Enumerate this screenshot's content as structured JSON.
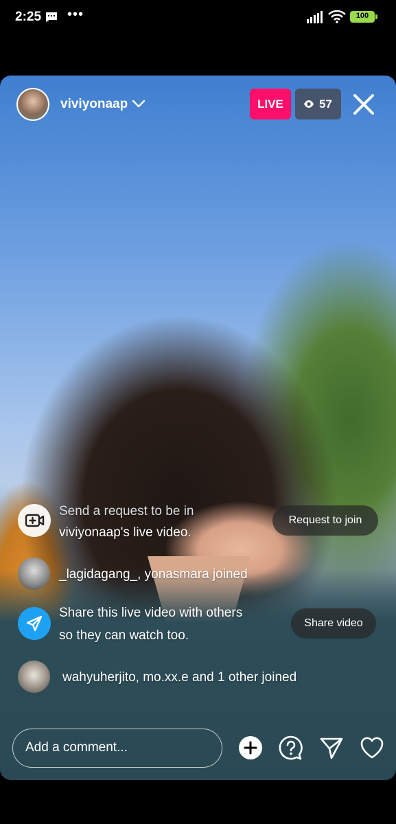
{
  "status_bar": {
    "time": "2:25",
    "battery": "100",
    "overflow": "•••"
  },
  "live": {
    "host_username": "viviyonaap",
    "live_label": "LIVE",
    "viewer_count": "57"
  },
  "feed": {
    "request_line1": "Send a request to be in",
    "request_line2": "viviyonaap's live video.",
    "request_button": "Request to join",
    "joined_1": "_lagidagang_, yonasmara joined",
    "share_line1": "Share this live video with others",
    "share_line2": "so they can watch too.",
    "share_button": "Share video",
    "joined_2": "wahyuherjito, mo.xx.e and 1 other joined"
  },
  "bottom_bar": {
    "comment_placeholder": "Add a comment..."
  },
  "colors": {
    "live_badge": "#ff0f6c",
    "share_icon_bg": "#1ea1f2",
    "battery": "#9ad84c"
  },
  "icons": [
    "message-icon",
    "signal-icon",
    "wifi-icon",
    "battery-icon",
    "chevron-down-icon",
    "eye-icon",
    "close-icon",
    "video-add-icon",
    "send-icon",
    "add-icon",
    "question-icon",
    "share-icon",
    "heart-icon"
  ]
}
